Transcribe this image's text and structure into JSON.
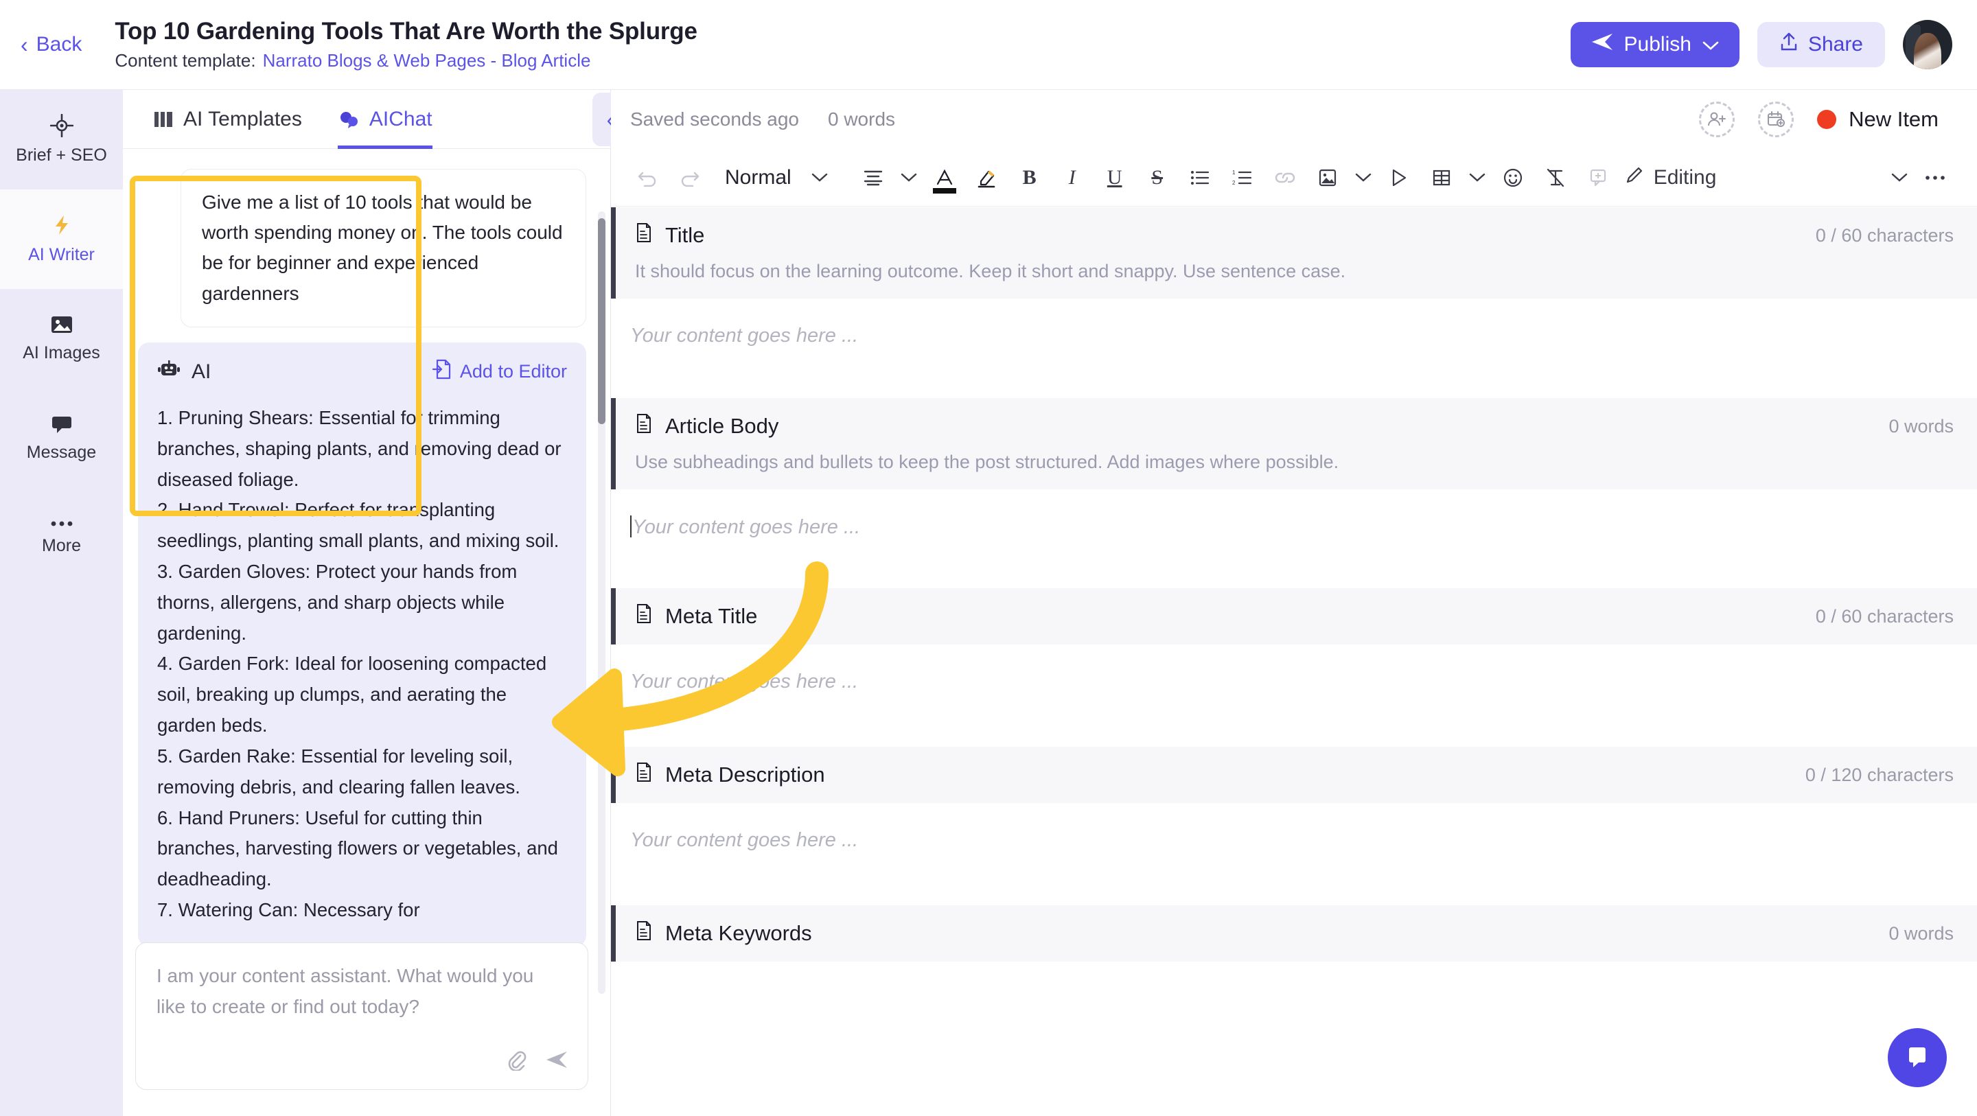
{
  "header": {
    "back_label": "Back",
    "doc_title": "Top 10 Gardening Tools That Are Worth the Splurge",
    "template_label": "Content template:",
    "template_name": "Narrato Blogs & Web Pages - Blog Article",
    "publish_label": "Publish",
    "share_label": "Share",
    "accent_color": "#5b53e8"
  },
  "rail": {
    "items": [
      {
        "label": "Brief + SEO",
        "icon": "target-icon",
        "active": false
      },
      {
        "label": "AI Writer",
        "icon": "lightning-icon",
        "active": true
      },
      {
        "label": "AI Images",
        "icon": "image-icon",
        "active": false
      },
      {
        "label": "Message",
        "icon": "chat-bubble-icon",
        "active": false
      },
      {
        "label": "More",
        "icon": "ellipsis-icon",
        "active": false
      }
    ]
  },
  "chat": {
    "tabs": [
      {
        "label": "AI Templates",
        "active": false
      },
      {
        "label": "AIChat",
        "active": true
      }
    ],
    "user_message": "Give me a list of 10 tools that would be worth spending money on. The tools could be for beginner and experienced gardenners",
    "ai_label": "AI",
    "add_to_editor_label": "Add to Editor",
    "ai_message": "1. Pruning Shears: Essential for trimming branches, shaping plants, and removing dead or diseased foliage.\n2. Hand Trowel: Perfect for transplanting seedlings, planting small plants, and mixing soil.\n3. Garden Gloves: Protect your hands from thorns, allergens, and sharp objects while gardening.\n4. Garden Fork: Ideal for loosening compacted soil, breaking up clumps, and aerating the garden beds.\n5. Garden Rake: Essential for leveling soil, removing debris, and clearing fallen leaves.\n6. Hand Pruners: Useful for cutting thin branches, harvesting flowers or vegetables, and deadheading.\n7. Watering Can: Necessary for",
    "composer_placeholder": "I am your content assistant. What would you like to create or find out today?"
  },
  "editor": {
    "saved_status": "Saved seconds ago",
    "word_count": "0 words",
    "new_item_label": "New Item",
    "new_item_color": "#ef3d21",
    "toolbar": {
      "undo": "undo-icon",
      "redo": "redo-icon",
      "style_label": "Normal",
      "editing_label": "Editing"
    },
    "sections": [
      {
        "title": "Title",
        "count": "0 / 60 characters",
        "hint": "It should focus on the learning outcome. Keep it short and snappy. Use sentence case.",
        "placeholder": "Your content goes here ..."
      },
      {
        "title": "Article Body",
        "count": "0 words",
        "hint": "Use subheadings and bullets to keep the post structured. Add images where possible.",
        "placeholder": "Your content goes here ..."
      },
      {
        "title": "Meta Title",
        "count": "0 / 60 characters",
        "hint": "",
        "placeholder": "Your content goes here ..."
      },
      {
        "title": "Meta Description",
        "count": "0 / 120 characters",
        "hint": "",
        "placeholder": "Your content goes here ..."
      },
      {
        "title": "Meta Keywords",
        "count": "0 words",
        "hint": "",
        "placeholder": ""
      }
    ]
  },
  "annotation": {
    "highlight_color": "#fcc832"
  }
}
